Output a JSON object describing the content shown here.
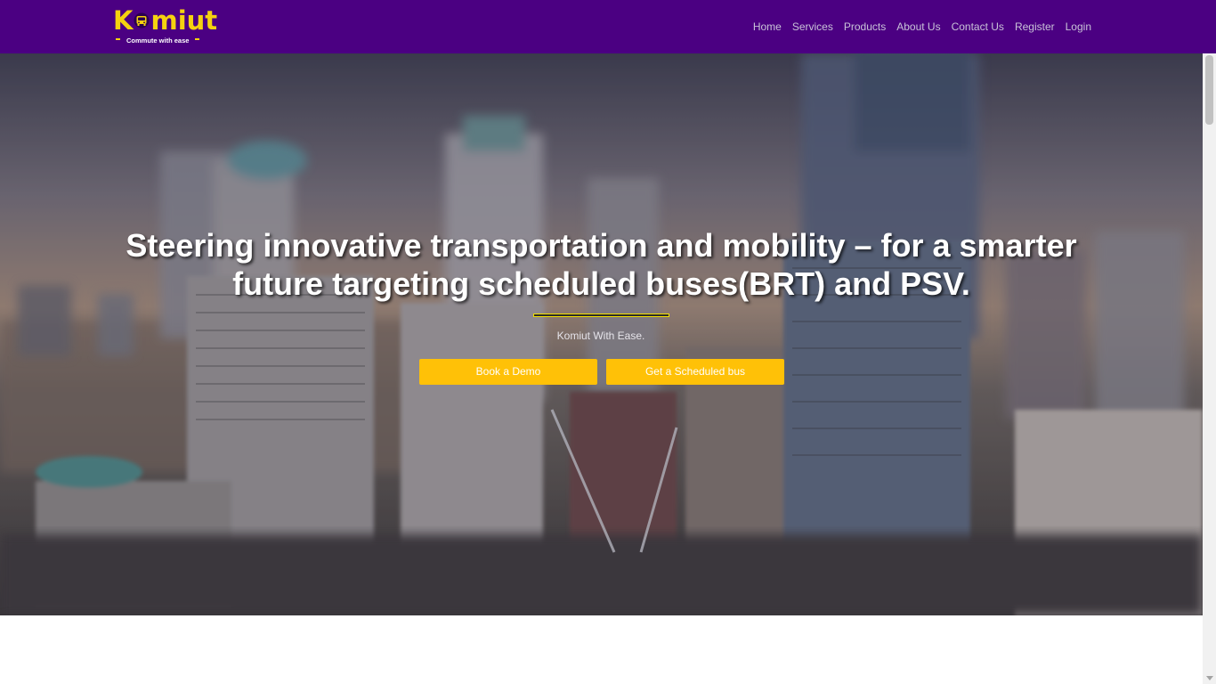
{
  "brand": {
    "name": "Komiut",
    "name_prefix": "K",
    "name_suffix": "miut",
    "tagline": "Commute with ease",
    "color_primary": "#4b0082",
    "color_accent": "#f5d20f"
  },
  "nav": {
    "items": [
      {
        "label": "Home"
      },
      {
        "label": "Services"
      },
      {
        "label": "Products"
      },
      {
        "label": "About Us"
      },
      {
        "label": "Contact Us"
      },
      {
        "label": "Register"
      },
      {
        "label": "Login"
      }
    ]
  },
  "hero": {
    "title": "Steering innovative transportation and mobility – for a smarter future targeting scheduled buses(BRT) and PSV.",
    "subtitle": "Komiut With Ease.",
    "buttons": {
      "demo_label": "Book a Demo",
      "bus_label": "Get a Scheduled bus"
    },
    "button_color": "#ffc107",
    "divider_color": "#f2e000",
    "background_icon": "city-skyline-photo"
  }
}
